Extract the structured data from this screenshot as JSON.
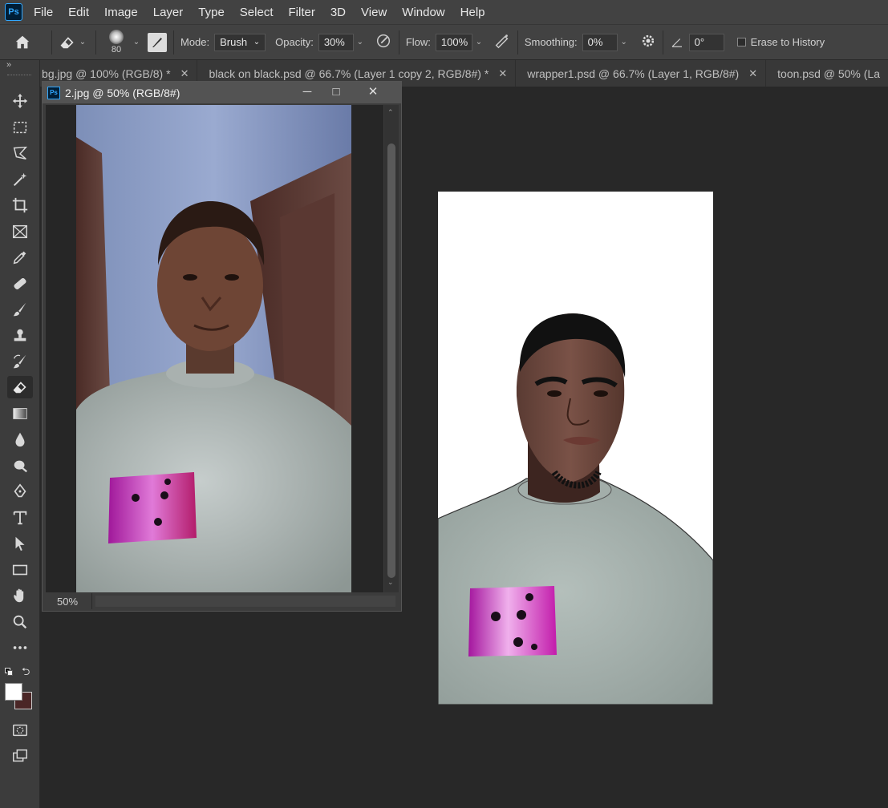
{
  "app": {
    "logo": "Ps"
  },
  "menu": [
    "File",
    "Edit",
    "Image",
    "Layer",
    "Type",
    "Select",
    "Filter",
    "3D",
    "View",
    "Window",
    "Help"
  ],
  "options": {
    "brush_size": "80",
    "mode_label": "Mode:",
    "mode_value": "Brush",
    "opacity_label": "Opacity:",
    "opacity_value": "30%",
    "flow_label": "Flow:",
    "flow_value": "100%",
    "smoothing_label": "Smoothing:",
    "smoothing_value": "0%",
    "angle_value": "0°",
    "erase_history_label": "Erase to History"
  },
  "tabs": [
    {
      "label": "bg.jpg @ 100% (RGB/8) *"
    },
    {
      "label": "black on black.psd @ 66.7% (Layer 1 copy 2, RGB/8#) *"
    },
    {
      "label": "wrapper1.psd @ 66.7% (Layer 1, RGB/8#)"
    },
    {
      "label": "toon.psd @ 50% (La"
    }
  ],
  "document": {
    "title": "2.jpg @ 50% (RGB/8#)",
    "zoom": "50%"
  },
  "colors": {
    "foreground": "#ffffff",
    "background": "#4a2626",
    "accent": "#31a8ff"
  },
  "tools": [
    "move-icon",
    "marquee-icon",
    "lasso-icon",
    "magic-wand-icon",
    "crop-icon",
    "frame-icon",
    "eyedropper-icon",
    "healing-brush-icon",
    "brush-icon",
    "stamp-icon",
    "history-brush-icon",
    "eraser-icon",
    "gradient-icon",
    "blur-icon",
    "dodge-icon",
    "pen-icon",
    "type-icon",
    "path-select-icon",
    "rectangle-icon",
    "hand-icon",
    "zoom-icon",
    "more-icon"
  ]
}
